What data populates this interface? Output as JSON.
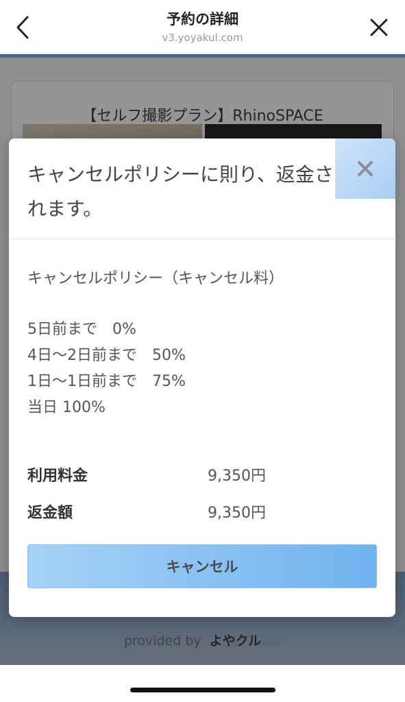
{
  "header": {
    "title": "予約の詳細",
    "url": "v3.yoyakul.com",
    "back_icon": "chevron-left-icon",
    "close_icon": "close-icon"
  },
  "background": {
    "card_title": "【セルフ撮影プラン】RhinoSPACE",
    "provided_by": "provided by",
    "brand": "よやクル",
    "brand_suffix": "PRO"
  },
  "modal": {
    "title": "キャンセルポリシーに則り、返金されます。",
    "close_icon": "close-icon",
    "policy_heading": "キャンセルポリシー（キャンセル料）",
    "policy_lines": [
      "5日前まで　0%",
      "4日〜2日前まで　50%",
      "1日〜1日前まで　75%",
      "当日 100%"
    ],
    "fees": [
      {
        "label": "利用料金",
        "value": "9,350円"
      },
      {
        "label": "返金額",
        "value": "9,350円"
      }
    ],
    "cancel_button": "キャンセル"
  },
  "colors": {
    "accent_blue": "#70b2ef",
    "header_strip": "#4b6584"
  }
}
